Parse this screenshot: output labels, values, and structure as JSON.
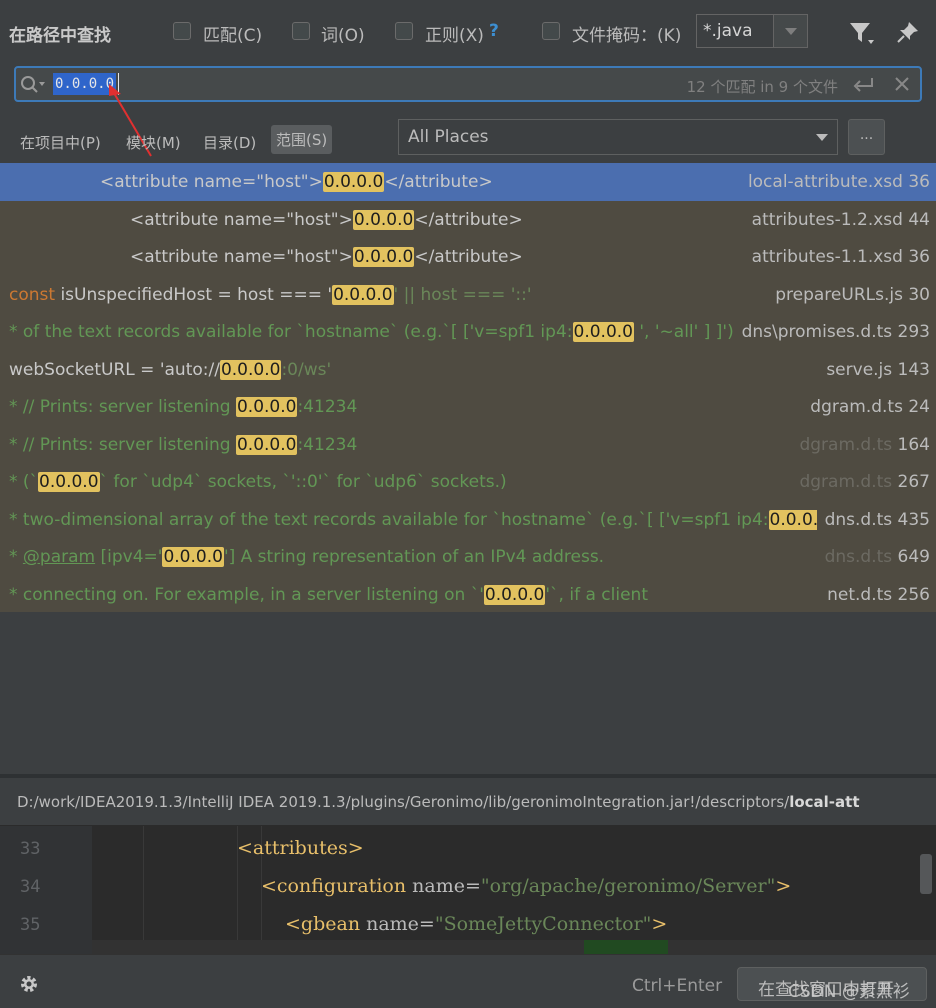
{
  "header": {
    "title": "在路径中查找",
    "options": [
      {
        "label": "匹配(C)",
        "checked": false
      },
      {
        "label": "词(O)",
        "checked": false
      },
      {
        "label": "正则(X)",
        "checked": false
      }
    ],
    "regex_help": "?",
    "file_mask_label": "文件掩码：(K)",
    "file_mask_checked": false,
    "file_mask_value": "*.java"
  },
  "search": {
    "query": "0.0.0.0",
    "match_count": "12 个匹配 in 9 个文件"
  },
  "scope": {
    "tabs": [
      "在项目中(P)",
      "模块(M)",
      "目录(D)",
      "范围(S)"
    ],
    "selected_tab": "范围(S)",
    "places_value": "All Places",
    "more_label": "..."
  },
  "results": [
    {
      "pre": "<attribute name=\"host\">",
      "match": "0.0.0.0",
      "post": "</attribute>",
      "file": "local-attribute.xsd",
      "line": "36",
      "selected": true
    },
    {
      "pre": "<attribute name=\"host\">",
      "match": "0.0.0.0",
      "post": "</attribute>",
      "file": "attributes-1.2.xsd",
      "line": "44"
    },
    {
      "pre": "<attribute name=\"host\">",
      "match": "0.0.0.0",
      "post": "</attribute>",
      "file": "attributes-1.1.xsd",
      "line": "36"
    },
    {
      "kw": "const",
      "pre": " isUnspecifiedHost = host === '",
      "match": "0.0.0.0",
      "post": "' || host === '::'",
      "file": "prepareURLs.js",
      "line": "30"
    },
    {
      "pre": "* of the text records available for `hostname` (e.g.`[ ['v=spf1 ip4:",
      "match": "0.0.0.0",
      "post": " ', '~all' ] ]'). Eac",
      "file": "dns\\promises.d.ts",
      "line": "293"
    },
    {
      "pre": "webSocketURL = 'auto://",
      "match": "0.0.0.0",
      "post": ":0/ws'",
      "file": "serve.js",
      "line": "143"
    },
    {
      "pre": "* // Prints: server listening ",
      "match": "0.0.0.0",
      "post": ":41234",
      "file": "dgram.d.ts",
      "line": "24"
    },
    {
      "pre": "* // Prints: server listening ",
      "match": "0.0.0.0",
      "post": ":41234",
      "file": "dgram.d.ts",
      "line": "164",
      "dim": true
    },
    {
      "pre": "* (`",
      "match": "0.0.0.0",
      "post": "` for `udp4` sockets, `'::0'` for `udp6` sockets.)",
      "file": "dgram.d.ts",
      "line": "267",
      "dim": true
    },
    {
      "pre": "* two-dimensional array of the text records available for `hostname` (e.g.`[ ['v=spf1 ip4:",
      "match": "0.0.0.0",
      "post": " ',",
      "file": "dns.d.ts",
      "line": "435"
    },
    {
      "tag": "@param",
      "pre": " [ipv4='",
      "match": "0.0.0.0",
      "post": "'] A string representation of an IPv4 address.",
      "file": "dns.d.ts",
      "line": "649",
      "dim": true
    },
    {
      "pre": "* connecting on. For example, in a server listening on `'",
      "match": "0.0.0.0",
      "post": "'`, if a client",
      "file": "net.d.ts",
      "line": "256"
    }
  ],
  "preview": {
    "path_prefix": "D:/work/IDEA2019.1.3/IntelliJ IDEA 2019.1.3/plugins/Geronimo/lib/geronimoIntegration.jar!/descriptors/",
    "path_file": "local-att",
    "lines": [
      {
        "num": "33",
        "text": "<attributes>"
      },
      {
        "num": "34",
        "tag_open": "<configuration ",
        "attr": "name=",
        "value": "\"org/apache/geronimo/Server\"",
        "tag_close": ">"
      },
      {
        "num": "35",
        "tag_open": "<gbean ",
        "attr": "name=",
        "value": "\"SomeJettyConnector\"",
        "tag_close": ">"
      }
    ]
  },
  "footer": {
    "shortcut": "Ctrl+Enter",
    "open_button": "在查找窗口中打开",
    "watermark": "CSDN @素黑衫"
  },
  "colors": {
    "selection": "#4b6eaf",
    "match_highlight": "#e2c25f",
    "results_bg": "#4f4b41",
    "accent": "#3d7ab8",
    "annotation_arrow": "#e03030"
  }
}
